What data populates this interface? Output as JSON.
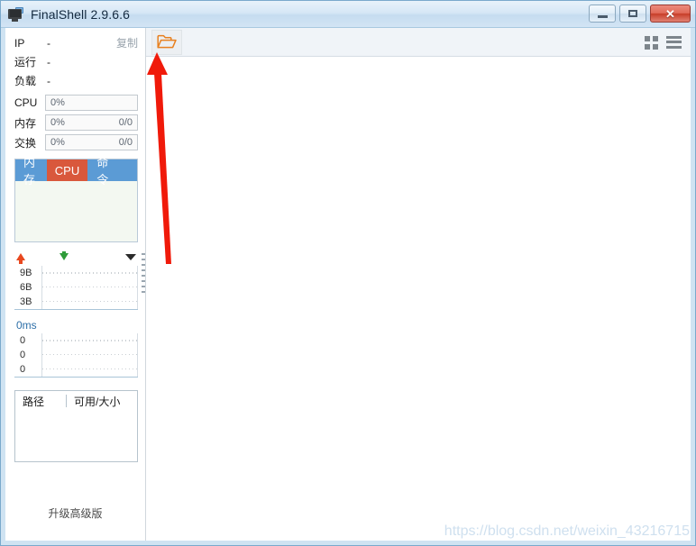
{
  "window": {
    "title": "FinalShell 2.9.6.6",
    "app_icon": "monitor-icon",
    "minimize_label": "",
    "maximize_label": "",
    "close_label": "✕"
  },
  "sidebar": {
    "info_rows": [
      {
        "label": "IP",
        "value": "-",
        "action": "复制"
      },
      {
        "label": "运行",
        "value": "-",
        "action": ""
      },
      {
        "label": "负载",
        "value": "-",
        "action": ""
      }
    ],
    "meters": [
      {
        "label": "CPU",
        "percent": "0%",
        "detail": ""
      },
      {
        "label": "内存",
        "percent": "0%",
        "detail": "0/0"
      },
      {
        "label": "交换",
        "percent": "0%",
        "detail": "0/0"
      }
    ],
    "tabs": [
      {
        "label": "内存",
        "active": false
      },
      {
        "label": "CPU",
        "active": true
      },
      {
        "label": "命令",
        "active": false
      }
    ],
    "network_graph": {
      "upload_icon": "arrow-up-icon",
      "download_icon": "arrow-down-icon",
      "menu_icon": "chevron-down-icon",
      "y_ticks": [
        "9B",
        "6B",
        "3B"
      ]
    },
    "ping_graph": {
      "title": "0ms",
      "y_ticks": [
        "0",
        "0",
        "0"
      ]
    },
    "disk_table": {
      "columns": [
        "路径",
        "可用/大小"
      ],
      "rows": []
    },
    "upgrade_label": "升级高级版"
  },
  "main": {
    "toolbar": {
      "open_folder_label": "",
      "open_folder_icon": "open-folder-icon",
      "grid_view_icon": "grid-view-icon",
      "list_view_icon": "list-view-icon"
    },
    "content": ""
  },
  "annotation": {
    "arrow_color": "#f01a0a",
    "points_to": "open-folder-icon"
  },
  "watermark": {
    "text": "https://blog.csdn.net/weixin_43216715"
  },
  "colors": {
    "titlebar_gradient_top": "#e8f2fa",
    "titlebar_gradient_bottom": "#d2e4f4",
    "window_frame": "#cfe3f2",
    "tab_blue": "#5b9bd5",
    "tab_active_orange": "#d9583c",
    "folder_orange": "#e8801f",
    "upload_arrow": "#e8481f",
    "download_arrow": "#2f9c3a",
    "ping_title": "#2d6fa8",
    "close_button": "#c73d28"
  }
}
